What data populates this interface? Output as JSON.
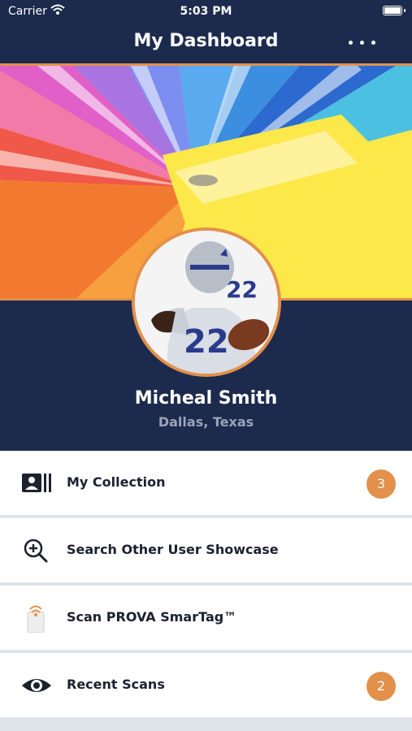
{
  "status_bar": {
    "carrier": "Carrier",
    "time": "5:03 PM"
  },
  "header": {
    "title": "My Dashboard",
    "more_icon": "more-horizontal-icon"
  },
  "profile": {
    "name": "Micheal Smith",
    "location": "Dallas, Texas",
    "cover": "color-swatch-fan-image",
    "avatar": "football-player-photo"
  },
  "menu": {
    "items": [
      {
        "label": "My Collection",
        "icon": "collection-icon",
        "badge": "3"
      },
      {
        "label": "Search Other User Showcase",
        "icon": "search-plus-icon"
      },
      {
        "label": "Scan PROVA SmarTag™",
        "icon": "phone-scan-icon"
      },
      {
        "label": "Recent Scans",
        "icon": "eye-icon",
        "badge": "2"
      }
    ]
  },
  "colors": {
    "navy": "#1c2a4d",
    "accent": "#e2904a",
    "separator": "#dfe3ea",
    "text": "#1c2130"
  }
}
